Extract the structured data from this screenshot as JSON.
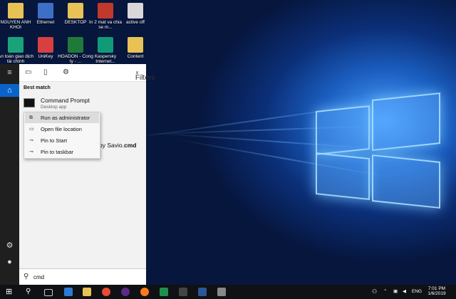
{
  "desktop": {
    "icons": [
      {
        "label": "NGUYEN ANH KHOI",
        "color": "#e8c255"
      },
      {
        "label": "Ethernet",
        "color": "#3d6fc7"
      },
      {
        "label": "DESKTOP",
        "color": "#e8c255"
      },
      {
        "label": "In 2 mat va chia se m...",
        "color": "#c0392b"
      },
      {
        "label": "active off",
        "color": "#d8d8d8"
      },
      {
        "label": "An toàn giao dịch tài chính",
        "color": "#1aa37a"
      },
      {
        "label": "UniKey",
        "color": "#d64040"
      },
      {
        "label": "HOADON - Cong ty - ...",
        "color": "#1f7a3a"
      },
      {
        "label": "Kaspersky Internet...",
        "color": "#119a78"
      },
      {
        "label": "Content",
        "color": "#e8c255"
      }
    ]
  },
  "start_menu": {
    "filters_label": "Filters",
    "best_match_label": "Best match",
    "result_title": "Command Prompt",
    "result_subtitle": "Desktop app",
    "second_result_prefix": "by Savio.",
    "second_result_bold": "cmd",
    "context_menu": [
      {
        "label": "Run as administrator",
        "icon": "shield-run-icon",
        "selected": true
      },
      {
        "label": "Open file location",
        "icon": "folder-icon",
        "selected": false
      },
      {
        "label": "Pin to Start",
        "icon": "pin-icon",
        "selected": false
      },
      {
        "label": "Pin to taskbar",
        "icon": "pin-icon",
        "selected": false
      }
    ],
    "search_query": "cmd"
  },
  "taskbar": {
    "language": "ENG",
    "time": "7:01 PM",
    "date": "1/6/2019"
  }
}
